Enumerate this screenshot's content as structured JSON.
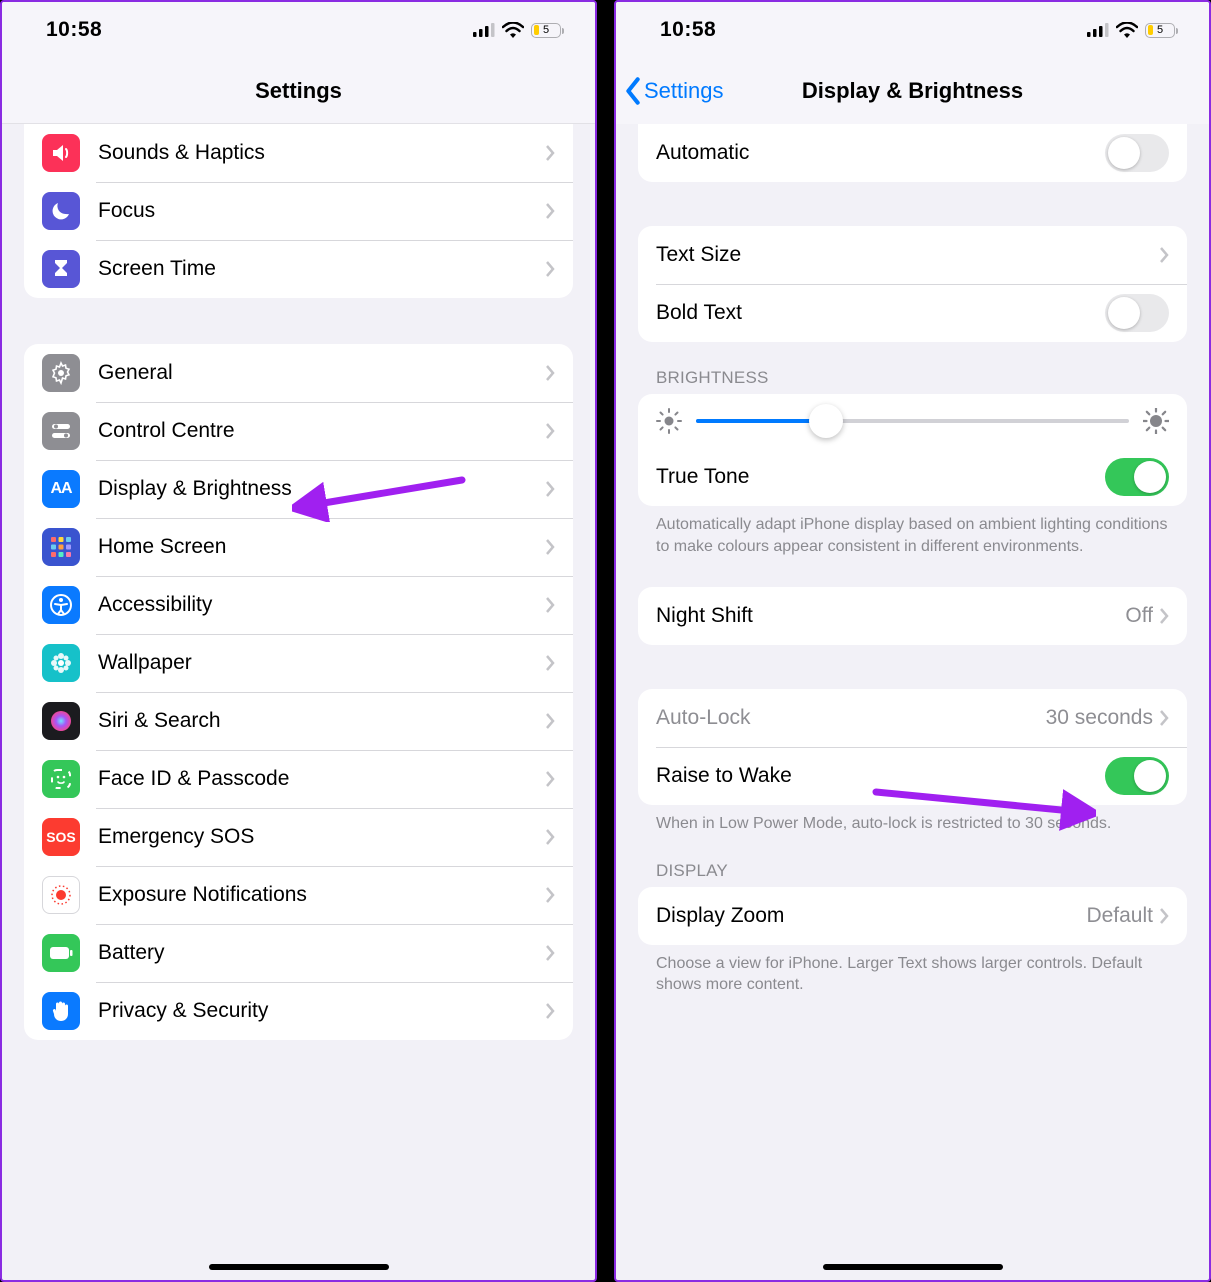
{
  "status": {
    "time": "10:58",
    "battery": "5"
  },
  "left": {
    "title": "Settings",
    "group1": [
      {
        "name": "sounds-haptics",
        "label": "Sounds & Haptics",
        "icon": "speaker",
        "color": "#fc3158"
      },
      {
        "name": "focus",
        "label": "Focus",
        "icon": "moon",
        "color": "#5856d6"
      },
      {
        "name": "screen-time",
        "label": "Screen Time",
        "icon": "hourglass",
        "color": "#5856d6"
      }
    ],
    "group2": [
      {
        "name": "general",
        "label": "General",
        "icon": "gear",
        "color": "#8e8e93"
      },
      {
        "name": "control-centre",
        "label": "Control Centre",
        "icon": "switches",
        "color": "#8e8e93"
      },
      {
        "name": "display-brightness",
        "label": "Display & Brightness",
        "icon": "aa",
        "color": "#0a7aff"
      },
      {
        "name": "home-screen",
        "label": "Home Screen",
        "icon": "grid",
        "color": "#3a54cf"
      },
      {
        "name": "accessibility",
        "label": "Accessibility",
        "icon": "access",
        "color": "#0a7aff"
      },
      {
        "name": "wallpaper",
        "label": "Wallpaper",
        "icon": "flower",
        "color": "#16c1c9"
      },
      {
        "name": "siri-search",
        "label": "Siri & Search",
        "icon": "siri",
        "color": "#1b1b1f"
      },
      {
        "name": "faceid-passcode",
        "label": "Face ID & Passcode",
        "icon": "face",
        "color": "#34c759"
      },
      {
        "name": "emergency-sos",
        "label": "Emergency SOS",
        "icon": "sos",
        "color": "#fc3b30"
      },
      {
        "name": "exposure-notifications",
        "label": "Exposure Notifications",
        "icon": "exposure",
        "color": "#ffffff"
      },
      {
        "name": "battery",
        "label": "Battery",
        "icon": "battery",
        "color": "#34c759"
      },
      {
        "name": "privacy-security",
        "label": "Privacy & Security",
        "icon": "hand",
        "color": "#0a7aff"
      }
    ]
  },
  "right": {
    "back": "Settings",
    "title": "Display & Brightness",
    "automatic": {
      "label": "Automatic",
      "on": false
    },
    "text_size": {
      "label": "Text Size"
    },
    "bold_text": {
      "label": "Bold Text",
      "on": false
    },
    "brightness_header": "BRIGHTNESS",
    "brightness_value": 0.3,
    "true_tone": {
      "label": "True Tone",
      "on": true
    },
    "true_tone_footer": "Automatically adapt iPhone display based on ambient lighting conditions to make colours appear consistent in different environments.",
    "night_shift": {
      "label": "Night Shift",
      "value": "Off"
    },
    "auto_lock": {
      "label": "Auto-Lock",
      "value": "30 seconds"
    },
    "raise_to_wake": {
      "label": "Raise to Wake",
      "on": true
    },
    "autolock_footer": "When in Low Power Mode, auto-lock is restricted to 30 seconds.",
    "display_header": "DISPLAY",
    "display_zoom": {
      "label": "Display Zoom",
      "value": "Default"
    },
    "display_zoom_footer": "Choose a view for iPhone. Larger Text shows larger controls. Default shows more content."
  }
}
